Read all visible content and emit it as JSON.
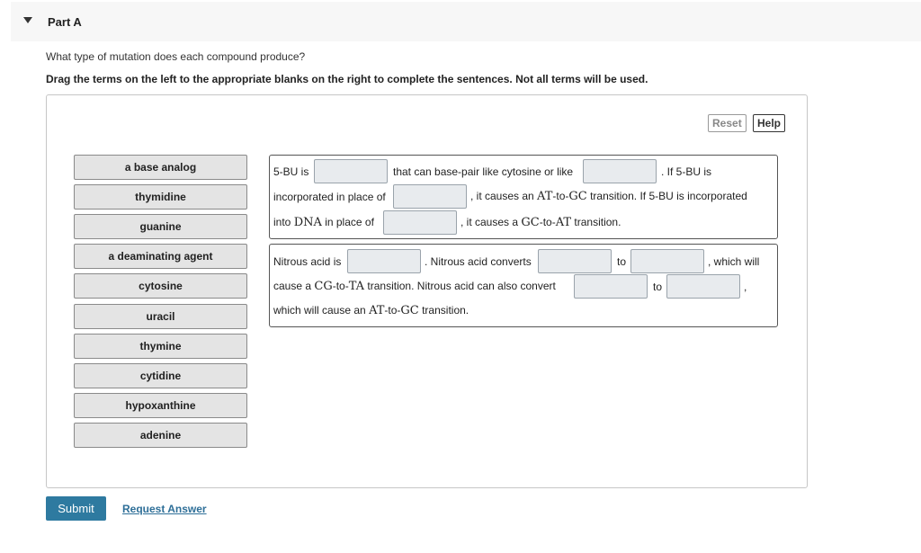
{
  "part": {
    "title": "Part A"
  },
  "question": "What type of mutation does each compound produce?",
  "instructions": "Drag the terms on the left to the appropriate blanks on the right to complete the sentences. Not all terms will be used.",
  "toolbar": {
    "reset_label": "Reset",
    "help_label": "Help"
  },
  "terms": [
    "a base analog",
    "thymidine",
    "guanine",
    "a deaminating agent",
    "cytosine",
    "uracil",
    "thymine",
    "cytidine",
    "hypoxanthine",
    "adenine"
  ],
  "sentence1": {
    "s1": "5-BU is",
    "s2": "that can base-pair like cytosine or like",
    "s3": ". If 5-BU is",
    "s4": "incorporated in place of",
    "s5a": ", it causes an ",
    "s5b": "AT",
    "s5c": "-to-",
    "s5d": "GC",
    "s5e": " transition. If 5-BU is incorporated",
    "s6a": "into ",
    "s6b": "DNA",
    "s6c": " in place of",
    "s7a": ", it causes a ",
    "s7b": "GC",
    "s7c": "-to-",
    "s7d": "AT",
    "s7e": " transition."
  },
  "sentence2": {
    "s1": "Nitrous acid is",
    "s2": ". Nitrous acid converts",
    "s3": "to",
    "s4": ", which will",
    "s5a": "cause a ",
    "s5b": "CG",
    "s5c": "-to-",
    "s5d": "TA",
    "s5e": " transition. Nitrous acid can also convert",
    "s6": "to",
    "s7": ",",
    "s8a": "which will cause an ",
    "s8b": "AT",
    "s8c": "-to-",
    "s8d": "GC",
    "s8e": " transition."
  },
  "footer": {
    "submit_label": "Submit",
    "request_label": "Request Answer"
  }
}
